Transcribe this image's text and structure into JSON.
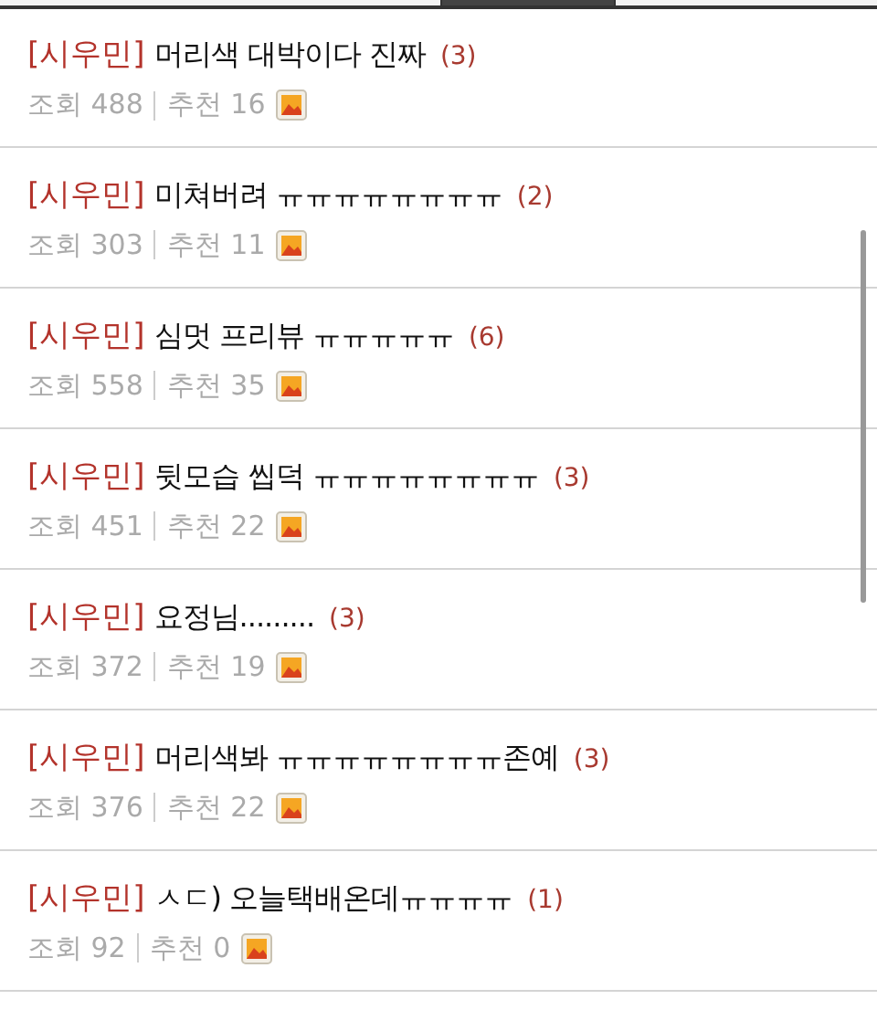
{
  "tabs": [
    {
      "selected": false
    },
    {
      "selected": true
    },
    {
      "selected": false
    }
  ],
  "posts": [
    {
      "tag": "[시우민]",
      "title": "머리색 대박이다 진짜",
      "comments": "(3)",
      "views": "조회 488",
      "likes": "추천 16",
      "has_image": true
    },
    {
      "tag": "[시우민]",
      "title": "미쳐버려 ㅠㅠㅠㅠㅠㅠㅠㅠ",
      "comments": "(2)",
      "views": "조회 303",
      "likes": "추천 11",
      "has_image": true
    },
    {
      "tag": "[시우민]",
      "title": "심멋 프리뷰 ㅠㅠㅠㅠㅠ",
      "comments": "(6)",
      "views": "조회 558",
      "likes": "추천 35",
      "has_image": true
    },
    {
      "tag": "[시우민]",
      "title": "뒷모습 씹덕 ㅠㅠㅠㅠㅠㅠㅠㅠ",
      "comments": "(3)",
      "views": "조회 451",
      "likes": "추천 22",
      "has_image": true
    },
    {
      "tag": "[시우민]",
      "title": "요정님.........",
      "comments": "(3)",
      "views": "조회 372",
      "likes": "추천 19",
      "has_image": true
    },
    {
      "tag": "[시우민]",
      "title": "머리색봐 ㅠㅠㅠㅠㅠㅠㅠㅠ존예",
      "comments": "(3)",
      "views": "조회 376",
      "likes": "추천 22",
      "has_image": true
    },
    {
      "tag": "[시우민]",
      "title": "ㅅㄷ) 오늘택배온데ㅠㅠㅠㅠ",
      "comments": "(1)",
      "views": "조회 92",
      "likes": "추천 0",
      "has_image": true
    }
  ]
}
